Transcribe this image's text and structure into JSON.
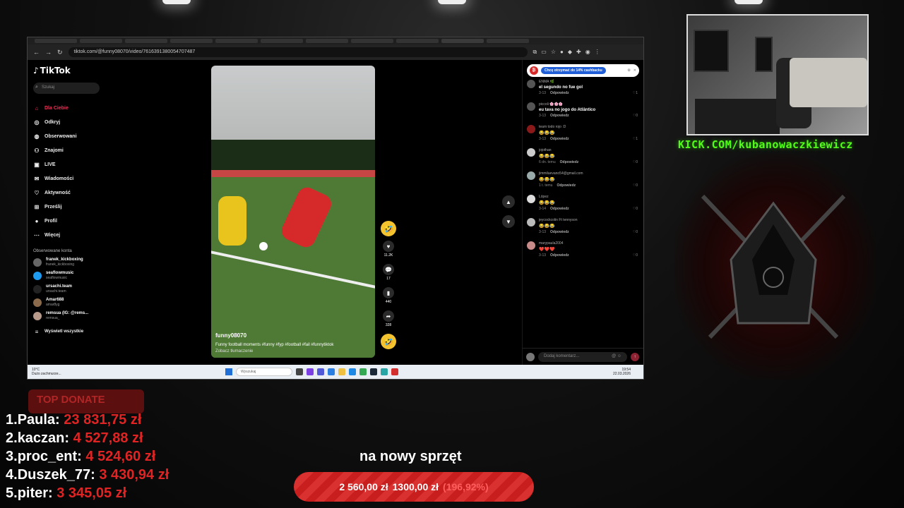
{
  "browser": {
    "url": "tiktok.com/@funny08070/video/7616391380054707487"
  },
  "tiktok": {
    "logo": "TikTok",
    "search_placeholder": "Szukaj",
    "nav": [
      {
        "label": "Dla Ciebie",
        "icon": "home-icon",
        "active": true
      },
      {
        "label": "Odkryj",
        "icon": "compass-icon"
      },
      {
        "label": "Obserwowani",
        "icon": "following-icon"
      },
      {
        "label": "Znajomi",
        "icon": "friends-icon"
      },
      {
        "label": "LIVE",
        "icon": "live-icon"
      },
      {
        "label": "Wiadomości",
        "icon": "messages-icon"
      },
      {
        "label": "Aktywność",
        "icon": "activity-icon"
      },
      {
        "label": "Prześlij",
        "icon": "upload-icon"
      },
      {
        "label": "Profil",
        "icon": "profile-icon"
      },
      {
        "label": "Więcej",
        "icon": "more-icon"
      }
    ],
    "followed_title": "Obserwowane konta",
    "followed": [
      {
        "name": "franek_kickboxing",
        "handle": "franek_kickboxing"
      },
      {
        "name": "seaflowmusic",
        "handle": "seaflowmusic"
      },
      {
        "name": "ursachi.team",
        "handle": "ursachi.team"
      },
      {
        "name": "Amar688",
        "handle": "amar8yg"
      },
      {
        "name": "remsua (IG: @rems...",
        "handle": "remsua_"
      }
    ],
    "show_all": "Wyświetl wszystkie",
    "video": {
      "user": "funny08070",
      "caption": "Funny football moments #funny #fyp #football #fail #funnytiktok",
      "translate": "Zobacz tłumaczenie"
    },
    "actions": {
      "likes": "11.2K",
      "comments": "17",
      "saves": "440",
      "shares": "328"
    },
    "cashback": "Chcę otrzymać do 14% cashbacku",
    "comments": [
      {
        "user": "ENMA 🌿",
        "text": "el segundo no fue gol",
        "date": "3-13",
        "reply": "Odpowiedz",
        "likes": "1"
      },
      {
        "user": "piccoli 🌸🌸🌸",
        "text": "eu tava no jogo do Atlântico",
        "date": "3-13",
        "reply": "Odpowiedz",
        "likes": "0"
      },
      {
        "user": "team todo rojo :D",
        "text": "😂😂😂",
        "date": "3-13",
        "reply": "Odpowiedz",
        "likes": "1"
      },
      {
        "user": "jojothan",
        "text": "😂😂😂",
        "date": "6 dn. temu",
        "reply": "Odpowiedz",
        "likes": "0"
      },
      {
        "user": "jimmiluevano54@gmail.com",
        "text": "😂😂😂",
        "date": "1 t. temu",
        "reply": "Odpowiedz",
        "likes": "0"
      },
      {
        "user": "López",
        "text": "😂😂😂",
        "date": "3-14",
        "reply": "Odpowiedz",
        "likes": "0"
      },
      {
        "user": "jeycockcolin Ft tennyson",
        "text": "😂😂😂",
        "date": "3-13",
        "reply": "Odpowiedz",
        "likes": "0"
      },
      {
        "user": "marypaula2004",
        "text": "❤️❤️❤️",
        "date": "3-13",
        "reply": "Odpowiedz",
        "likes": "0"
      }
    ],
    "comment_placeholder": "Dodaj komentarz..."
  },
  "taskbar": {
    "weather_temp": "10°C",
    "weather_desc": "Dużo zachmurze...",
    "search": "Wyszukaj",
    "time": "19:54",
    "date": "22.03.2026"
  },
  "overlay": {
    "kick": "KICK.COM/kubanowaczkiewicz",
    "top_donate": "TOP DONATE",
    "donations": [
      {
        "rank": "1.",
        "name": "Paula:",
        "amount": "23 831,75 zł"
      },
      {
        "rank": "2.",
        "name": "kaczan:",
        "amount": "4 527,88 zł"
      },
      {
        "rank": "3.",
        "name": "proc_ent:",
        "amount": "4 524,60 zł"
      },
      {
        "rank": "4.",
        "name": "Duszek_77:",
        "amount": "3 430,94 zł"
      },
      {
        "rank": "5.",
        "name": "piter:",
        "amount": "3 345,05 zł"
      }
    ],
    "goal_title": "na nowy sprzęt",
    "goal_current": "2 560,00 zł",
    "goal_target": "1300,00 zł",
    "goal_pct": "(196,92%)"
  }
}
